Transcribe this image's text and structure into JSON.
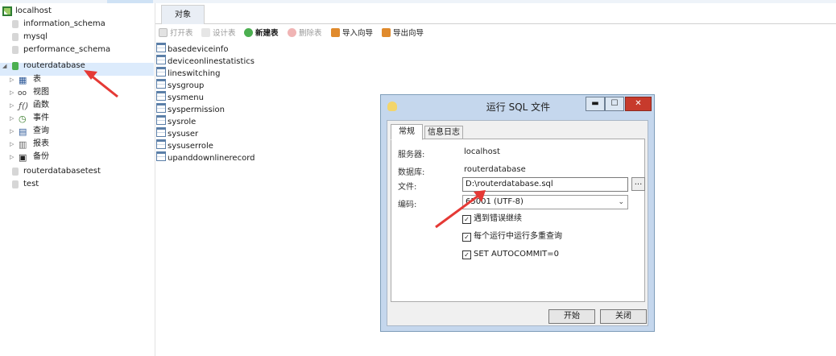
{
  "tree": {
    "connection": "localhost",
    "databases": [
      "information_schema",
      "mysql",
      "performance_schema"
    ],
    "open_database": "routerdatabase",
    "children": [
      {
        "icon": "table-icon",
        "label": "表"
      },
      {
        "icon": "view-icon",
        "label": "视图"
      },
      {
        "icon": "function-icon",
        "label": "函数"
      },
      {
        "icon": "event-icon",
        "label": "事件"
      },
      {
        "icon": "query-icon",
        "label": "查询"
      },
      {
        "icon": "report-icon",
        "label": "报表"
      },
      {
        "icon": "backup-icon",
        "label": "备份"
      }
    ],
    "more_databases": [
      "routerdatabasetest",
      "test"
    ]
  },
  "main": {
    "tab": "对象",
    "toolbar": {
      "open": "打开表",
      "design": "设计表",
      "new": "新建表",
      "delete": "删除表",
      "import": "导入向导",
      "export": "导出向导"
    },
    "tables": [
      "basedeviceinfo",
      "deviceonlinestatistics",
      "lineswitching",
      "sysgroup",
      "sysmenu",
      "syspermission",
      "sysrole",
      "sysuser",
      "sysuserrole",
      "upanddownlinerecord"
    ]
  },
  "dialog": {
    "title": "运行 SQL 文件",
    "tabs": [
      "常规",
      "信息日志"
    ],
    "server_label": "服务器:",
    "server_value": "localhost",
    "database_label": "数据库:",
    "database_value": "routerdatabase",
    "file_label": "文件:",
    "file_value": "D:\\routerdatabase.sql",
    "browse": "...",
    "encoding_label": "编码:",
    "encoding_value": "65001 (UTF-8)",
    "options": [
      {
        "label": "遇到错误继续",
        "checked": true
      },
      {
        "label": "每个运行中运行多重查询",
        "checked": true
      },
      {
        "label": "SET AUTOCOMMIT=0",
        "checked": true
      }
    ],
    "start": "开始",
    "close": "关闭"
  },
  "colors": {
    "selection": "#dcebfc",
    "arrow": "#e53935",
    "dialog_frame": "#c5d7ed",
    "close_button": "#c73a2c"
  }
}
